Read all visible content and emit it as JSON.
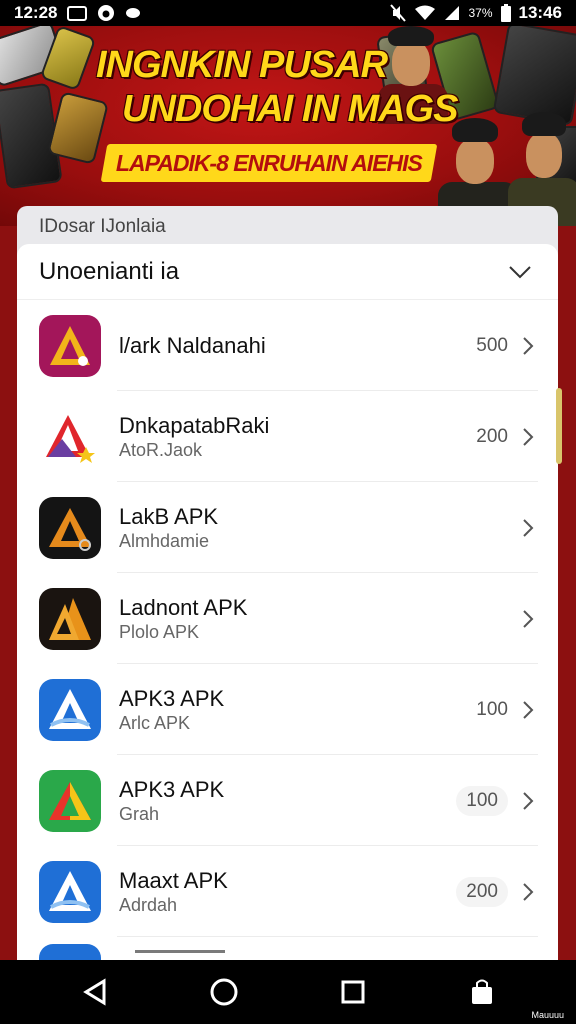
{
  "status_bar": {
    "left_time": "12:28",
    "battery_text": "37%",
    "right_time": "13:46"
  },
  "banner": {
    "title_line1": "INGNKIN PUSAR",
    "title_line2": "UNDOHAI IN MAGS",
    "ribbon_text": "LAPADIK-8 ENRUHAIN AIEHIS"
  },
  "back_sheet": {
    "title": "IDosar IJonlaia"
  },
  "sheet": {
    "title": "Unoenianti ia"
  },
  "apps": [
    {
      "name": "l/ark Naldanahi",
      "sub": "",
      "count": "500",
      "pill": false,
      "icon_colors": [
        "#a3165a",
        "#f2b41a"
      ]
    },
    {
      "name": "DnkapatabRaki",
      "sub": "AtoR.Jaok",
      "count": "200",
      "pill": false,
      "icon_colors": [
        "#ffffff",
        "#e0262c"
      ]
    },
    {
      "name": "LakB APK",
      "sub": "Almhdamie",
      "count": "",
      "pill": false,
      "icon_colors": [
        "#141414",
        "#e58a1c"
      ]
    },
    {
      "name": "Ladnont APK",
      "sub": "Plolo APK",
      "count": "",
      "pill": false,
      "icon_colors": [
        "#1a1410",
        "#e8921a"
      ]
    },
    {
      "name": "APK3 APK",
      "sub": "Arlc APK",
      "count": "100",
      "pill": false,
      "icon_colors": [
        "#1f6fd6",
        "#ffffff"
      ]
    },
    {
      "name": "APK3 APK",
      "sub": "Grah",
      "count": "100",
      "pill": true,
      "icon_colors": [
        "#2aa84a",
        "#e8332a"
      ]
    },
    {
      "name": "Maaxt APK",
      "sub": "Adrdah",
      "count": "200",
      "pill": true,
      "icon_colors": [
        "#1f6fd6",
        "#ffffff"
      ]
    }
  ],
  "nav": {
    "label": "Mauuuu"
  }
}
